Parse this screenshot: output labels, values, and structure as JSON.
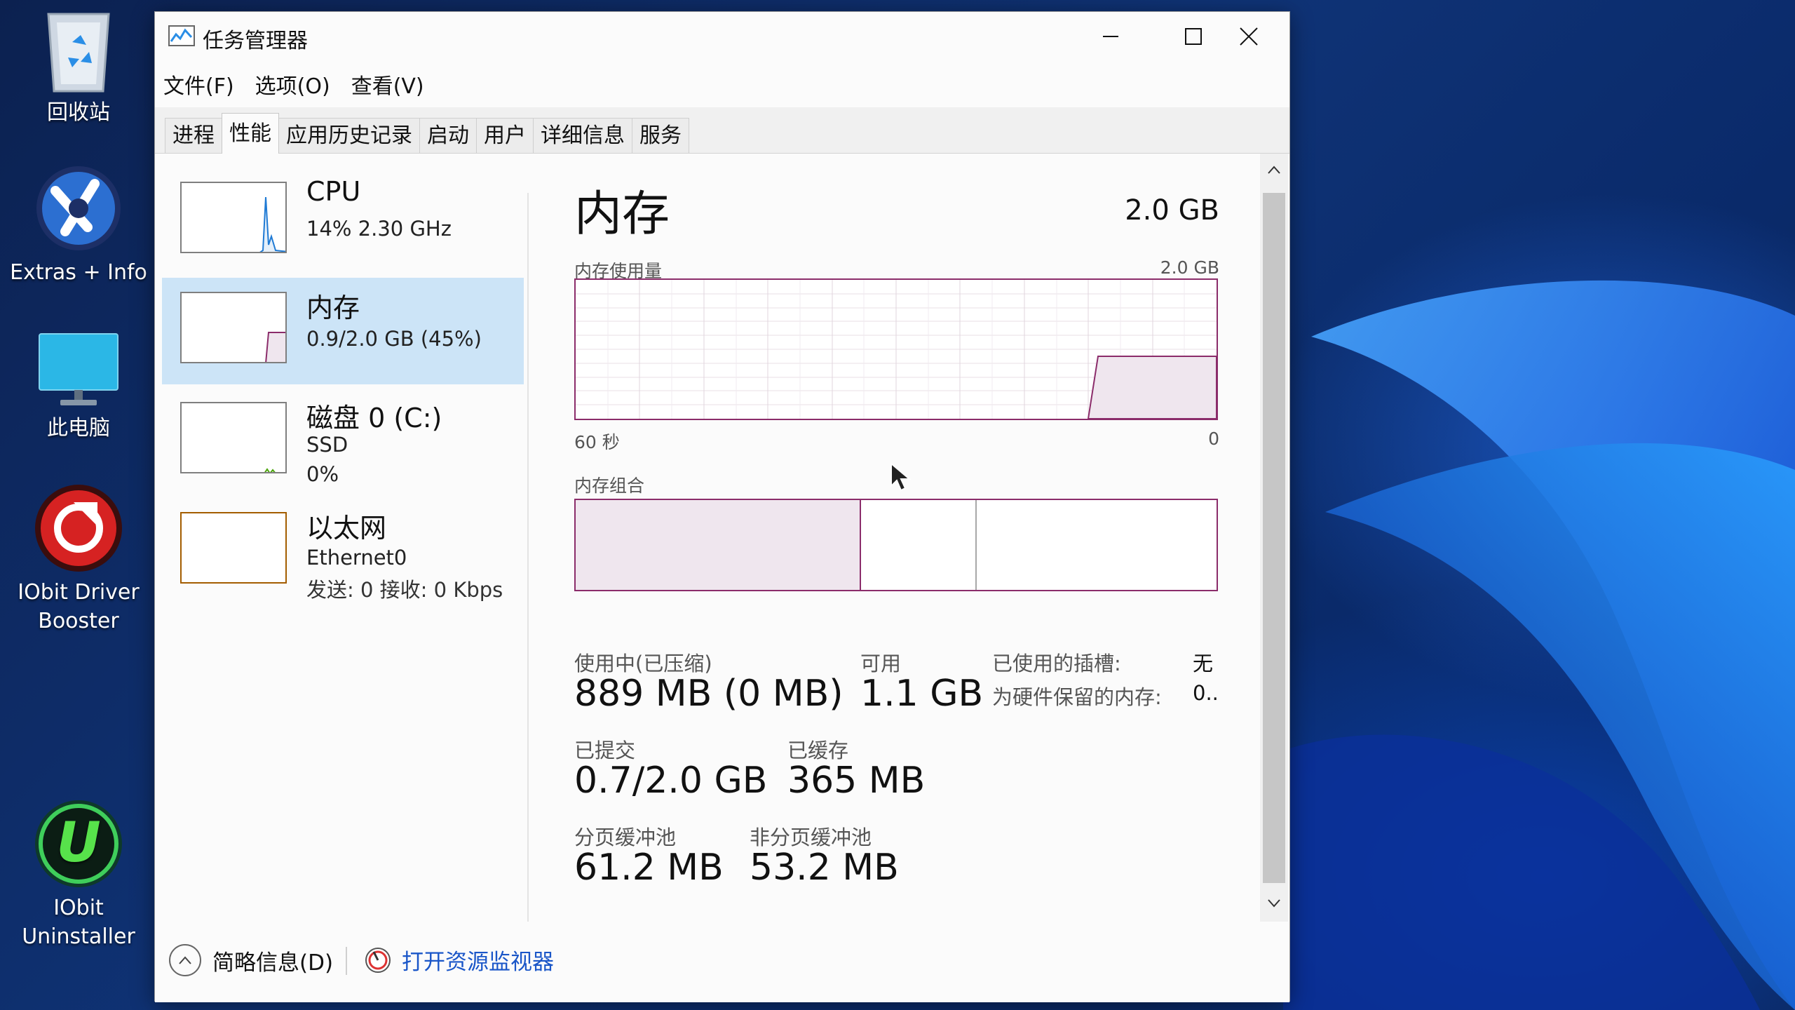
{
  "desktop": {
    "icons": [
      {
        "label": "回收站",
        "icon": "recycle-bin-icon"
      },
      {
        "label": "Extras + Info",
        "icon": "extras-info-icon"
      },
      {
        "label": "此电脑",
        "icon": "this-pc-icon"
      },
      {
        "label": "IObit Driver Booster",
        "icon": "driver-booster-icon"
      },
      {
        "label": "IObit Uninstaller",
        "icon": "iobit-uninstaller-icon"
      }
    ]
  },
  "window": {
    "title": "任务管理器",
    "icon": "task-manager-icon",
    "controls": {
      "minimize": "minimize-icon",
      "maximize": "maximize-icon",
      "close": "close-icon"
    }
  },
  "menu": [
    "文件(F)",
    "选项(O)",
    "查看(V)"
  ],
  "tabs": [
    {
      "label": "进程",
      "active": false
    },
    {
      "label": "性能",
      "active": true
    },
    {
      "label": "应用历史记录",
      "active": false
    },
    {
      "label": "启动",
      "active": false
    },
    {
      "label": "用户",
      "active": false
    },
    {
      "label": "详细信息",
      "active": false
    },
    {
      "label": "服务",
      "active": false
    }
  ],
  "sidebar": {
    "items": [
      {
        "name": "CPU",
        "line1": "14% 2.30 GHz",
        "line2": "",
        "line3": "",
        "selected": false,
        "accent": "#1f7ad4"
      },
      {
        "name": "内存",
        "line1": "0.9/2.0 GB (45%)",
        "line2": "",
        "line3": "",
        "selected": true,
        "accent": "#8b2c6a"
      },
      {
        "name": "磁盘 0 (C:)",
        "line1": "SSD",
        "line2": "0%",
        "line3": "",
        "selected": false,
        "accent": "#4da60c"
      },
      {
        "name": "以太网",
        "line1": "Ethernet0",
        "line2": "发送: 0 接收: 0 Kbps",
        "line3": "",
        "selected": false,
        "accent": "#a35d00"
      }
    ]
  },
  "memory": {
    "title": "内存",
    "total": "2.0 GB",
    "usage_label": "内存使用量",
    "usage_max": "2.0 GB",
    "time_left": "60 秒",
    "time_right": "0",
    "composition_label": "内存组合",
    "composition": {
      "in_use_fraction": 0.445,
      "modified_fraction": 0.18
    },
    "stats": {
      "in_use_label": "使用中(已压缩)",
      "in_use_value": "889 MB (0 MB)",
      "available_label": "可用",
      "available_value": "1.1 GB",
      "committed_label": "已提交",
      "committed_value": "0.7/2.0 GB",
      "cached_label": "已缓存",
      "cached_value": "365 MB",
      "paged_label": "分页缓冲池",
      "paged_value": "61.2 MB",
      "nonpaged_label": "非分页缓冲池",
      "nonpaged_value": "53.2 MB"
    },
    "details": {
      "slots_label": "已使用的插槽:",
      "slots_value": "无",
      "reserved_label": "为硬件保留的内存:",
      "reserved_value": "0.."
    },
    "graph_usage_fraction": 0.45
  },
  "footer": {
    "fewer_details": "简略信息(D)",
    "open_resmon": "打开资源监视器"
  },
  "colors": {
    "memory_accent": "#8b2c6a",
    "selected_bg": "#cce4f7",
    "link": "#1a56c8"
  }
}
